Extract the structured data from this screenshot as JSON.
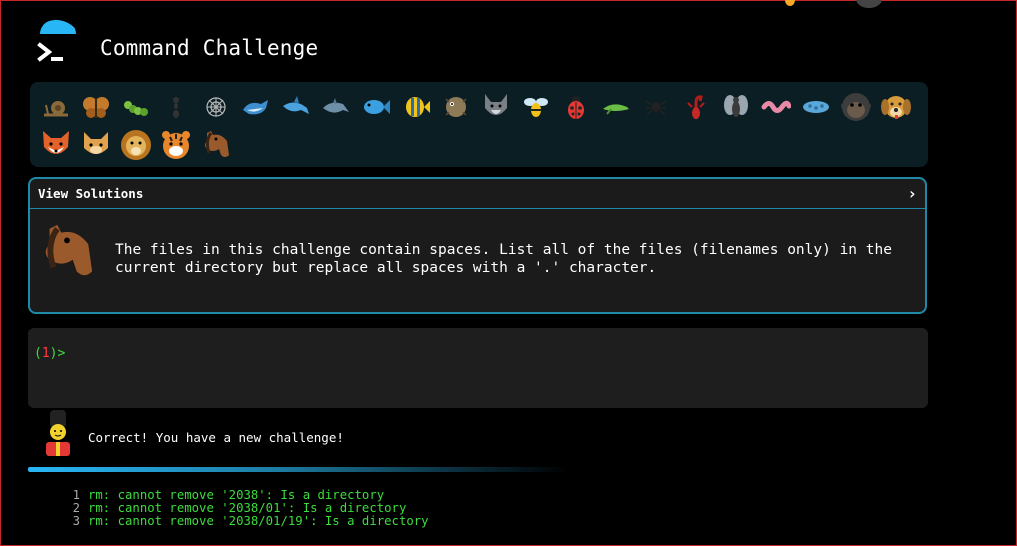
{
  "app": {
    "title": "Command Challenge"
  },
  "icons": {
    "logo": "terminal-prompt-icon",
    "emojis": [
      "snail-icon",
      "butterfly-icon",
      "caterpillar-icon",
      "ant-icon",
      "spider-web-icon",
      "whale-icon",
      "shark-icon",
      "dolphin-icon",
      "fish-icon",
      "tropical-fish-icon",
      "blowfish-icon",
      "wolf-icon",
      "bee-icon",
      "ladybug-icon",
      "cricket-icon",
      "spider-icon",
      "scorpion-icon",
      "fly-icon",
      "worm-icon",
      "microbe-icon",
      "gorilla-icon",
      "dog-icon",
      "fox-icon",
      "cat-icon",
      "lion-icon",
      "tiger-icon",
      "horse-icon"
    ]
  },
  "solutions": {
    "header_label": "View Solutions",
    "expand_glyph": "›",
    "challenge_text": "The files in this challenge contain spaces. List all of the files (filenames only) in the current directory but replace all spaces with a '.' character."
  },
  "terminal": {
    "prompt_open": "(",
    "prompt_number": "1",
    "prompt_close": ")>"
  },
  "feedback": {
    "message": "Correct! You have a new challenge!"
  },
  "output": {
    "lines": [
      {
        "n": "1",
        "text": "rm: cannot remove '2038': Is a directory"
      },
      {
        "n": "2",
        "text": "rm: cannot remove '2038/01': Is a directory"
      },
      {
        "n": "3",
        "text": "rm: cannot remove '2038/01/19': Is a directory"
      }
    ]
  },
  "colors": {
    "accent": "#1f8aa8",
    "prompt_green": "#3ddc3d",
    "prompt_red": "#ff3b3b",
    "emoji_bar_bg": "#0b1e24"
  }
}
